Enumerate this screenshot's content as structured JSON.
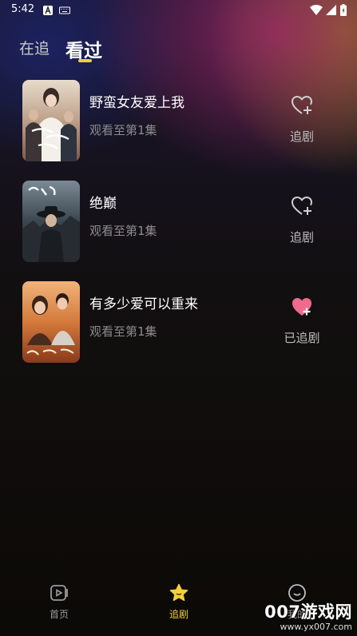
{
  "status_bar": {
    "time": "5:42"
  },
  "tabs": [
    {
      "label": "在追",
      "active": false
    },
    {
      "label": "看过",
      "active": true
    }
  ],
  "items": [
    {
      "title": "野蛮女友爱上我",
      "progress": "观看至第1集",
      "follow_label": "追剧",
      "followed": false
    },
    {
      "title": "绝巅",
      "progress": "观看至第1集",
      "follow_label": "追剧",
      "followed": false
    },
    {
      "title": "有多少爱可以重来",
      "progress": "观看至第1集",
      "follow_label": "已追剧",
      "followed": true
    }
  ],
  "bottom_nav": [
    {
      "label": "首页",
      "icon": "play-box-icon",
      "active": false
    },
    {
      "label": "追剧",
      "icon": "star-icon",
      "active": true
    },
    {
      "label": "我的",
      "icon": "smiley-icon",
      "active": false
    }
  ],
  "watermark": {
    "line1": "007游戏网",
    "line2": "www.yx007.com"
  },
  "colors": {
    "accent_yellow": "#f3cf3b",
    "followed_heart": "#f06a8e",
    "text_muted": "#8c8c8c"
  }
}
